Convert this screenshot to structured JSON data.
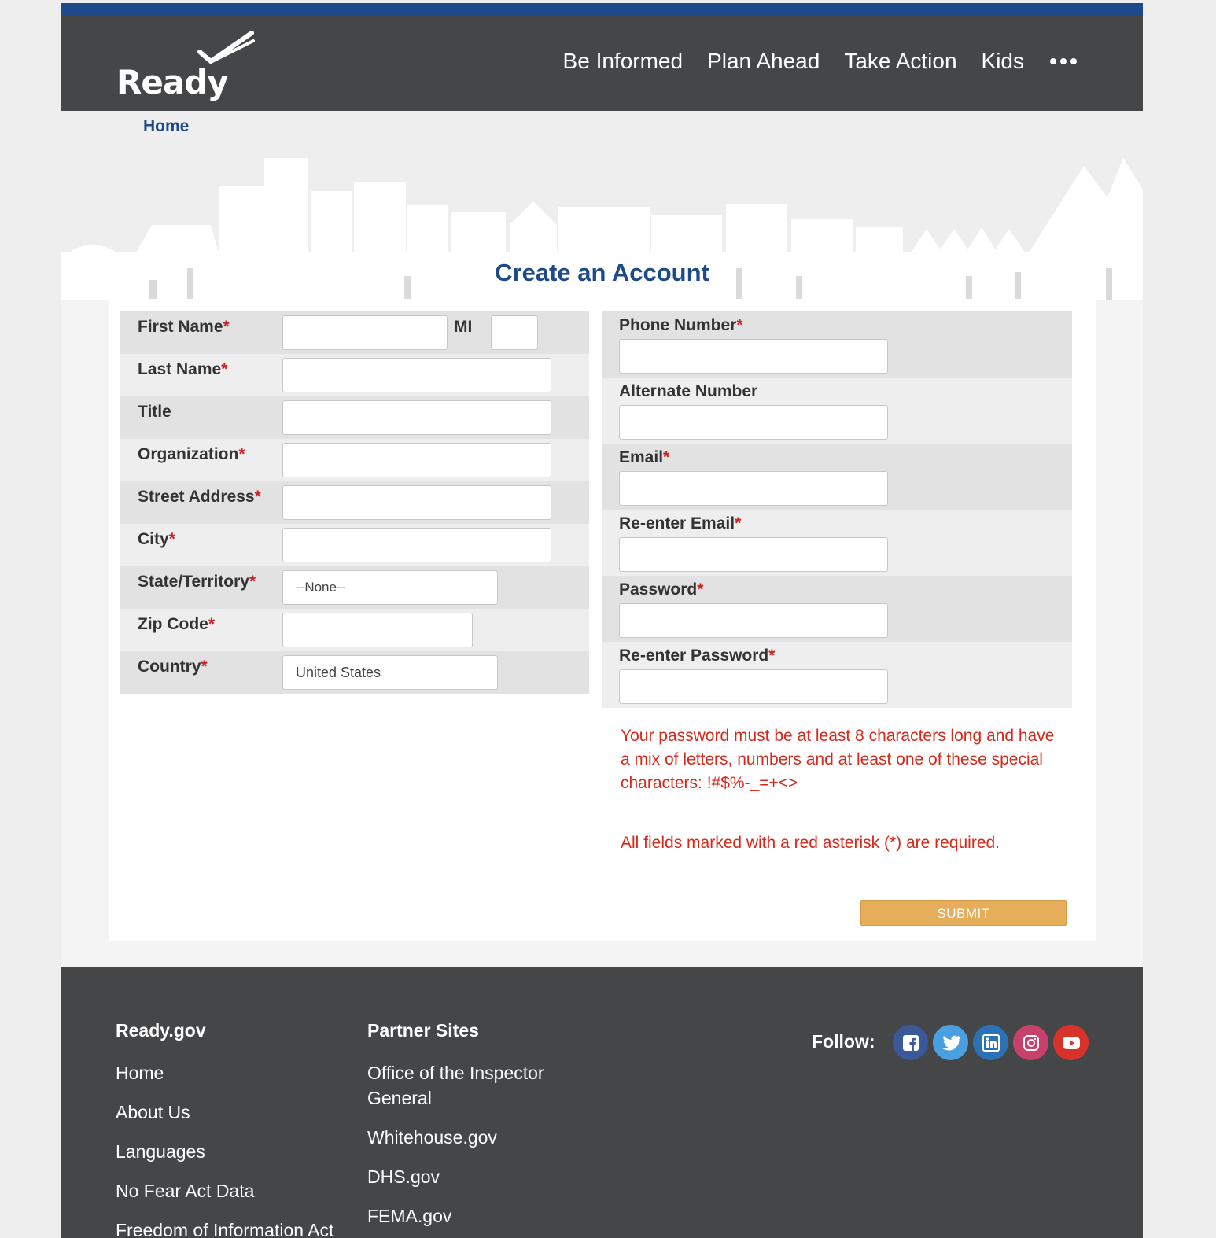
{
  "header": {
    "logo_text": "Ready",
    "nav": [
      "Be Informed",
      "Plan Ahead",
      "Take Action",
      "Kids"
    ]
  },
  "breadcrumb": "Home",
  "page_title": "Create an Account",
  "form_left": {
    "first_name": "First Name",
    "mi": "MI",
    "last_name": "Last Name",
    "title": "Title",
    "organization": "Organization",
    "street_address": "Street Address",
    "city": "City",
    "state": "State/Territory",
    "state_value": "--None--",
    "zip": "Zip Code",
    "country": "Country",
    "country_value": "United States",
    "asterisk": "*"
  },
  "form_right": {
    "phone": "Phone Number",
    "alternate": "Alternate Number",
    "email": "Email",
    "reenter_email": "Re-enter Email",
    "password": "Password",
    "reenter_password": "Re-enter Password"
  },
  "notes": {
    "password_rule": "Your password must be at least 8 characters long and have a mix of letters, numbers and at least one of these special characters: !#$%-_=+<>",
    "required": "All fields marked with a red asterisk (*) are required."
  },
  "submit_label": "SUBMIT",
  "footer": {
    "col1_title": "Ready.gov",
    "col1_links": [
      "Home",
      "About Us",
      "Languages",
      "No Fear Act Data",
      "Freedom of Information Act"
    ],
    "col2_title": "Partner Sites",
    "col2_links": [
      "Office of the Inspector General",
      "Whitehouse.gov",
      "DHS.gov",
      "FEMA.gov"
    ],
    "follow_label": "Follow:",
    "socials": [
      {
        "icon": "facebook-icon",
        "color": "#3b5998"
      },
      {
        "icon": "twitter-icon",
        "color": "#4a9fe0"
      },
      {
        "icon": "linkedin-icon",
        "color": "#2a72b4"
      },
      {
        "icon": "instagram-icon",
        "color": "#c8416c"
      },
      {
        "icon": "youtube-icon",
        "color": "#d9322b"
      }
    ]
  },
  "colors": {
    "brand_blue": "#1f4a8a",
    "header_gray": "#454648",
    "error_red": "#d42a1b",
    "submit_orange": "#e6ad5a"
  }
}
